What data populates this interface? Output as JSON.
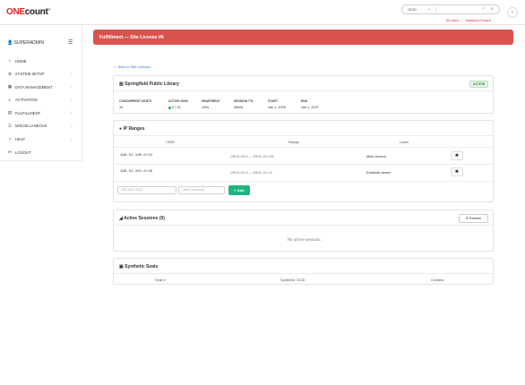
{
  "app": {
    "logo_one": "ONE",
    "logo_count": "count",
    "logo_tm": "®"
  },
  "search": {
    "select_value": "OCID",
    "all_users_link": "All Users",
    "advanced_search_link": "Advanced Search"
  },
  "sidebar": {
    "user": "SUPERADMIN",
    "items": [
      {
        "label": "HOME",
        "icon": "home-icon",
        "glyph": "⌂",
        "has_arrow": false
      },
      {
        "label": "SYSTEM SETUP",
        "icon": "gear-icon",
        "glyph": "⚙",
        "has_arrow": true
      },
      {
        "label": "DATA MANAGEMENT",
        "icon": "database-icon",
        "glyph": "▦",
        "has_arrow": true
      },
      {
        "label": "ACTIVATION",
        "icon": "toggle-icon",
        "glyph": "◐",
        "has_arrow": true
      },
      {
        "label": "FULFILLMENT",
        "icon": "box-icon",
        "glyph": "▤",
        "has_arrow": true
      },
      {
        "label": "MISCELLANEOUS",
        "icon": "list-icon",
        "glyph": "☰",
        "has_arrow": true
      },
      {
        "label": "HELP",
        "icon": "question-icon",
        "glyph": "?",
        "has_arrow": true
      },
      {
        "label": "LOGOUT",
        "icon": "logout-icon",
        "glyph": "↦",
        "has_arrow": false
      }
    ]
  },
  "banner": {
    "title": "Fulfillment — Site License #6"
  },
  "back_link": "← Back to Site Licenses",
  "license": {
    "name": "Springfield Public Library",
    "status": "ACTIVE",
    "fields": [
      {
        "key": "CONCURRENT SEATS",
        "value": "15"
      },
      {
        "key": "ACTIVE NOW",
        "value": "0 / 15"
      },
      {
        "key": "HEARTBEAT",
        "value": "120s"
      },
      {
        "key": "SESSION TTL",
        "value": "3600s"
      },
      {
        "key": "START",
        "value": "Jan 1, 2026"
      },
      {
        "key": "END",
        "value": "Jan 1, 2027"
      }
    ]
  },
  "ip_ranges": {
    "title": "IP Ranges",
    "columns": [
      "CIDR",
      "Range",
      "Label"
    ],
    "rows": [
      {
        "cidr": "198.51.100.0/24",
        "range": "198.51.100.0 — 198.51.100.255",
        "label": "Main branch"
      },
      {
        "cidr": "198.51.101.0/28",
        "range": "198.51.101.0 — 198.51.101.15",
        "label": "Eastside annex"
      }
    ],
    "cidr_placeholder": "198.168.1.0/24",
    "label_placeholder": "Label (optional)",
    "add_label": "+ Add"
  },
  "sessions": {
    "title": "Active Sessions (0)",
    "refresh_label": "⟳ Refresh",
    "empty_text": "No active sessions."
  },
  "seats": {
    "title": "Synthetic Seats",
    "columns": [
      "Seat #",
      "Synthetic OCID",
      "Created"
    ]
  },
  "colors": {
    "brand_red": "#e0262b",
    "banner": "#d9534f",
    "success": "#1fb67e",
    "link": "#3a7bd5"
  }
}
